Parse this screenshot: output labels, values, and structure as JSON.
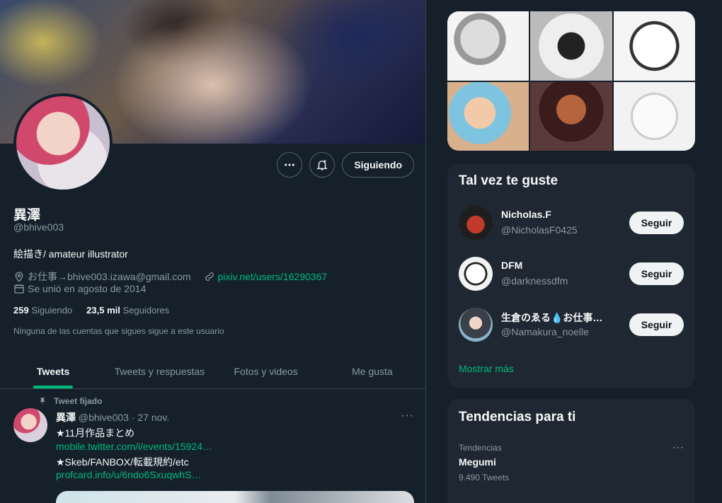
{
  "profile": {
    "name": "異澤",
    "handle": "@bhive003",
    "bio": "絵描き/ amateur illustrator",
    "location": "お仕事→bhive003.izawa@gmail.com",
    "website": "pixiv.net/users/16290367",
    "joined": "Se unió en agosto de 2014",
    "following_count": "259",
    "following_label": "Siguiendo",
    "followers_count": "23,5 mil",
    "followers_label": "Seguidores",
    "no_common_followers": "Ninguna de las cuentas que sigues sigue a este usuario"
  },
  "actions": {
    "more_icon": "more-icon",
    "notify_icon": "bell-add-icon",
    "follow_label": "Siguiendo"
  },
  "tabs": [
    {
      "label": "Tweets",
      "active": true
    },
    {
      "label": "Tweets y respuestas",
      "active": false
    },
    {
      "label": "Fotos y videos",
      "active": false
    },
    {
      "label": "Me gusta",
      "active": false
    }
  ],
  "tweet": {
    "pinned_label": "Tweet fijado",
    "author": "異澤",
    "handle": "@bhive003",
    "sep": "·",
    "date": "27 nov.",
    "line1": "★11月作品まとめ",
    "link1": "mobile.twitter.com/i/events/15924…",
    "line2": "★Skeb/FANBOX/転載規約/etc",
    "link2": "profcard.info/u/6ndo6SxuqwhS…"
  },
  "suggestions": {
    "title": "Tal vez te guste",
    "users": [
      {
        "name": "Nicholas.F",
        "handle": "@NicholasF0425",
        "button": "Seguir"
      },
      {
        "name": "DFM",
        "handle": "@darknessdfm",
        "button": "Seguir"
      },
      {
        "name": "生倉のゑる💧お仕事…",
        "handle": "@Namakura_noelle",
        "button": "Seguir"
      }
    ],
    "show_more": "Mostrar más"
  },
  "trends": {
    "title": "Tendencias para ti",
    "items": [
      {
        "category": "Tendencias",
        "name": "Megumi",
        "count": "9.490 Tweets"
      }
    ]
  },
  "colors": {
    "background": "#15202b",
    "accent": "#00ba7c",
    "muted": "#8b98a5"
  }
}
